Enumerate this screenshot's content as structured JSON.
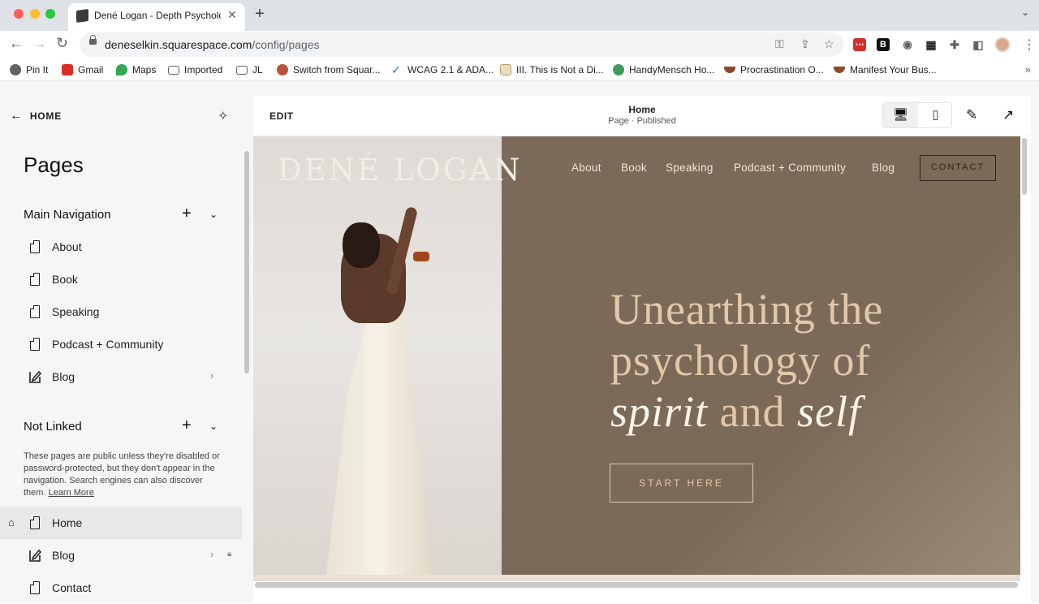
{
  "browser": {
    "tab_title": "Dené Logan - Depth Psycholo",
    "tab_close": "✕",
    "new_tab": "+",
    "tab_menu": "⌄",
    "url_host": "deneselkin.squarespace.com",
    "url_path": "/config/pages",
    "back": "←",
    "forward": "→",
    "reload": "↻",
    "bookmarks": [
      {
        "label": "Pin It",
        "icon": "pinterest-icon",
        "color": "#5f6368"
      },
      {
        "label": "Gmail",
        "icon": "gmail-icon",
        "color": "#d93025"
      },
      {
        "label": "Maps",
        "icon": "maps-icon",
        "color": "#34a853"
      },
      {
        "label": "Imported",
        "icon": "folder-icon",
        "color": "#5f6368"
      },
      {
        "label": "JL",
        "icon": "folder-icon",
        "color": "#5f6368"
      },
      {
        "label": "Switch from Squar...",
        "icon": "site-icon",
        "color": "#b5563a"
      },
      {
        "label": "WCAG 2.1 & ADA...",
        "icon": "checkmark-icon",
        "color": "#2d6cdf"
      },
      {
        "label": "III. This is Not a Di...",
        "icon": "site-icon",
        "color": "#b8a26a"
      },
      {
        "label": "HandyMensch Ho...",
        "icon": "globe-icon",
        "color": "#3f9b5a"
      },
      {
        "label": "Procrastination O...",
        "icon": "bowl-icon",
        "color": "#8a4a2a"
      },
      {
        "label": "Manifest Your Bus...",
        "icon": "bowl-icon",
        "color": "#8a4a2a"
      }
    ],
    "bookmarks_more": "»"
  },
  "sidebar": {
    "home_label": "HOME",
    "pages_title": "Pages",
    "main_nav_title": "Main Navigation",
    "main_nav_items": [
      "About",
      "Book",
      "Speaking",
      "Podcast + Community",
      "Blog"
    ],
    "not_linked_title": "Not Linked",
    "note_text": "These pages are public unless they're disabled or password-protected, but they don't appear in the navigation. Search engines can also discover them.",
    "note_link": "Learn More",
    "not_linked_items": [
      "Home",
      "Blog",
      "Contact"
    ],
    "plus": "+",
    "chevron": "⌄"
  },
  "editor": {
    "edit_label": "EDIT",
    "page_title": "Home",
    "page_status": "Page · Published"
  },
  "site": {
    "logo": "DENÉ LOGAN",
    "nav": [
      "About",
      "Book",
      "Speaking",
      "Podcast + Community",
      "Blog"
    ],
    "contact": "CONTACT",
    "headline_1": "Unearthing the",
    "headline_2": "psychology of",
    "headline_3a": "spirit",
    "headline_3b": " and ",
    "headline_3c": "self",
    "cta": "START HERE",
    "colors": {
      "panel": "#7b6a58",
      "headline": "#e2c8aa",
      "emphasis": "#fbf3e8"
    }
  }
}
